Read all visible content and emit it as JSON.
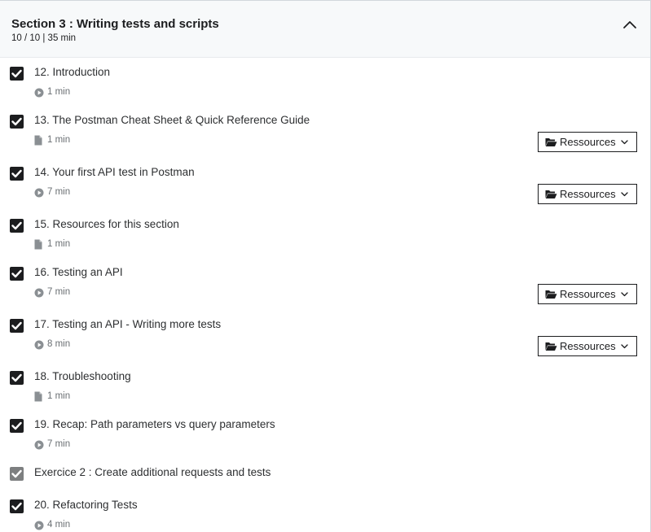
{
  "section": {
    "title": "Section 3 : Writing tests and scripts",
    "progress": "10 / 10 | 35 min",
    "expanded": true
  },
  "resources_label": "Ressources",
  "lectures": [
    {
      "title": "12. Introduction",
      "type": "video",
      "duration": "1 min",
      "completed": true,
      "has_resources": false
    },
    {
      "title": "13. The Postman Cheat Sheet & Quick Reference Guide",
      "type": "article",
      "duration": "1 min",
      "completed": true,
      "has_resources": true
    },
    {
      "title": "14. Your first API test in Postman",
      "type": "video",
      "duration": "7 min",
      "completed": true,
      "has_resources": true
    },
    {
      "title": "15. Resources for this section",
      "type": "article",
      "duration": "1 min",
      "completed": true,
      "has_resources": false
    },
    {
      "title": "16. Testing an API",
      "type": "video",
      "duration": "7 min",
      "completed": true,
      "has_resources": true
    },
    {
      "title": "17. Testing an API - Writing more tests",
      "type": "video",
      "duration": "8 min",
      "completed": true,
      "has_resources": true
    },
    {
      "title": "18. Troubleshooting",
      "type": "article",
      "duration": "1 min",
      "completed": true,
      "has_resources": false
    },
    {
      "title": "19. Recap: Path parameters vs query parameters",
      "type": "video",
      "duration": "7 min",
      "completed": true,
      "has_resources": false
    },
    {
      "title": "Exercice 2 : Create additional requests and tests",
      "type": "exercise",
      "completed": true,
      "has_resources": false
    },
    {
      "title": "20. Refactoring Tests",
      "type": "video",
      "duration": "4 min",
      "completed": true,
      "has_resources": false
    }
  ],
  "colors": {
    "header_bg": "#f7f9fa",
    "checkbox": "#1c1d1f",
    "checkbox_muted": "#7d7f80",
    "meta_text": "#6a6f73"
  }
}
